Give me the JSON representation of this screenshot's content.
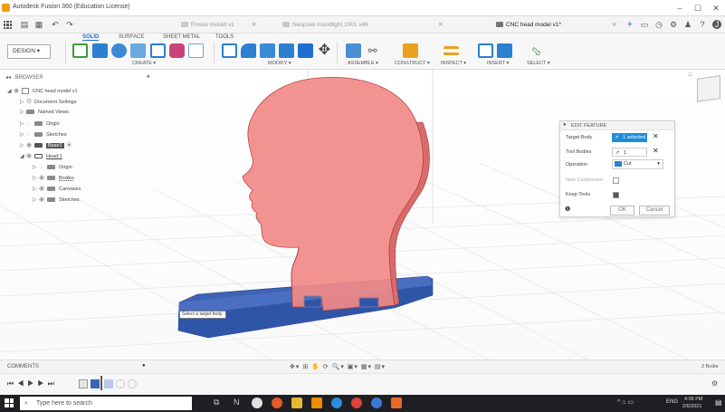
{
  "window": {
    "title": "Autodesk Fusion 360 (Education License)",
    "minimize": "–",
    "maximize": "☐",
    "close": "✕"
  },
  "tabs": [
    {
      "label": "Flower mould v1",
      "active": false
    },
    {
      "label": "Neopixel moodlight 1001 v46",
      "active": false
    },
    {
      "label": "CNC head model v1*",
      "active": true
    }
  ],
  "toolbar": {
    "workspace_label": "DESIGN ▾",
    "workspace_tabs": [
      "SOLID",
      "SURFACE",
      "SHEET METAL",
      "TOOLS"
    ],
    "groups": [
      "CREATE ▾",
      "MODIFY ▾",
      "ASSEMBLE ▾",
      "CONSTRUCT ▾",
      "INSPECT ▾",
      "INSERT ▾",
      "SELECT ▾"
    ]
  },
  "browser": {
    "title": "BROWSER",
    "items": [
      {
        "label": "CNC head model v1"
      },
      {
        "label": "Document Settings"
      },
      {
        "label": "Named Views"
      },
      {
        "label": "Origin"
      },
      {
        "label": "Sketches"
      },
      {
        "label": "Base1"
      },
      {
        "label": "Head:1"
      },
      {
        "label": "Origin"
      },
      {
        "label": "Bodies"
      },
      {
        "label": "Canvases"
      },
      {
        "label": "Sketches"
      }
    ]
  },
  "edit_feature": {
    "title": "EDIT FEATURE",
    "target_body_label": "Target Body",
    "target_body_value": "1 selected",
    "tool_bodies_label": "Tool Bodies",
    "tool_bodies_value": "1 selected",
    "operation_label": "Operation",
    "operation_value": "Cut",
    "new_component_label": "New Component",
    "keep_tools_label": "Keep Tools",
    "ok_label": "OK",
    "cancel_label": "Cancel"
  },
  "viewport": {
    "tooltip": "Select a target body",
    "body_count": "2 Bodie",
    "colors": {
      "head": "#f08080",
      "base": "#3f63b4"
    }
  },
  "comments": {
    "label": "COMMENTS"
  },
  "taskbar": {
    "search_placeholder": "Type here to search",
    "lang": "ENG",
    "time": "4:06 PM",
    "date": "2/6/2021"
  }
}
